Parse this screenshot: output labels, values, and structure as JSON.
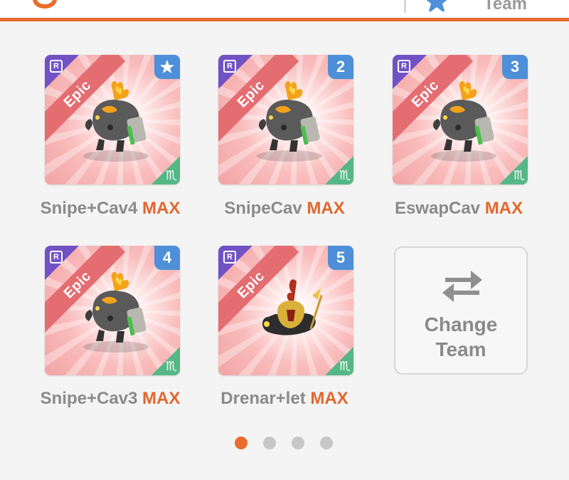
{
  "colors": {
    "accent": "#ea6b2d",
    "epic_red": "#e46d72",
    "rarity_purple": "#7052c4",
    "slot_blue": "#4d8fd8",
    "element_green": "#55b786"
  },
  "header": {
    "team_label_partial": "Team",
    "icons": [
      "logo-icon",
      "star-icon"
    ]
  },
  "team": {
    "max_label": "MAX",
    "rarity_label": "Epic",
    "tier_badge": "R",
    "element_glyph": "♏",
    "slots": [
      {
        "slot": "star",
        "name": "Snipe+Cav4"
      },
      {
        "slot": "2",
        "name": "SnipeCav"
      },
      {
        "slot": "3",
        "name": "EswapCav"
      },
      {
        "slot": "4",
        "name": "Snipe+Cav3"
      },
      {
        "slot": "5",
        "name": "Drenar+let"
      }
    ]
  },
  "change_team": {
    "line1": "Change",
    "line2": "Team",
    "icon": "swap-arrows-icon"
  },
  "pager": {
    "pages": 4,
    "current": 1
  }
}
